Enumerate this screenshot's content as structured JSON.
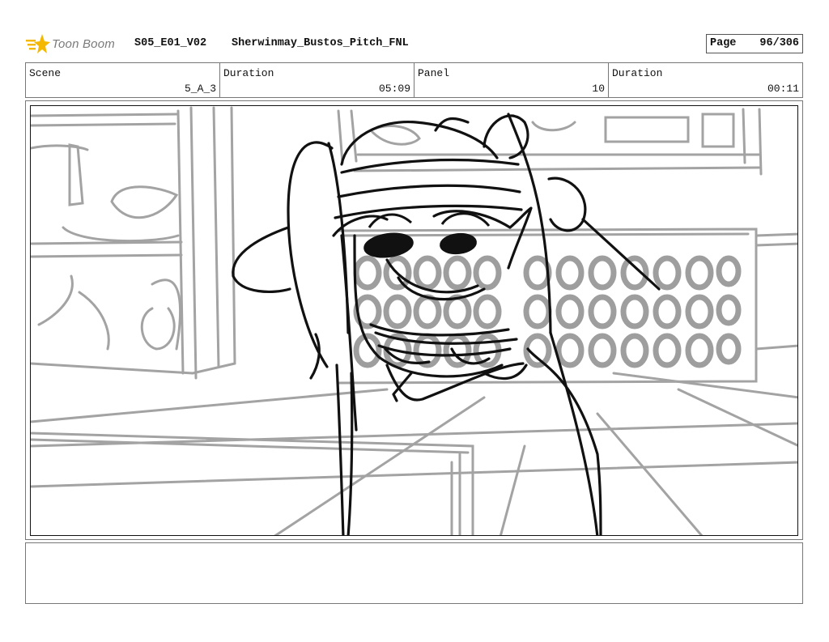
{
  "header": {
    "logo_text": "Toon Boom",
    "project_code": "S05_E01_V02",
    "file_name": "Sherwinmay_Bustos_Pitch_FNL",
    "page_label": "Page",
    "page_value": "96/306"
  },
  "info": {
    "scene_label": "Scene",
    "scene_value": "5_A_3",
    "duration_label": "Duration",
    "duration_value": "05:09",
    "panel_label": "Panel",
    "panel_value": "10",
    "panel_duration_label": "Duration",
    "panel_duration_value": "00:11"
  },
  "notes": {
    "text": ""
  },
  "colors": {
    "logo_accent": "#f5b800",
    "sketch_dark": "#111111",
    "sketch_light": "#9e9e9e"
  }
}
